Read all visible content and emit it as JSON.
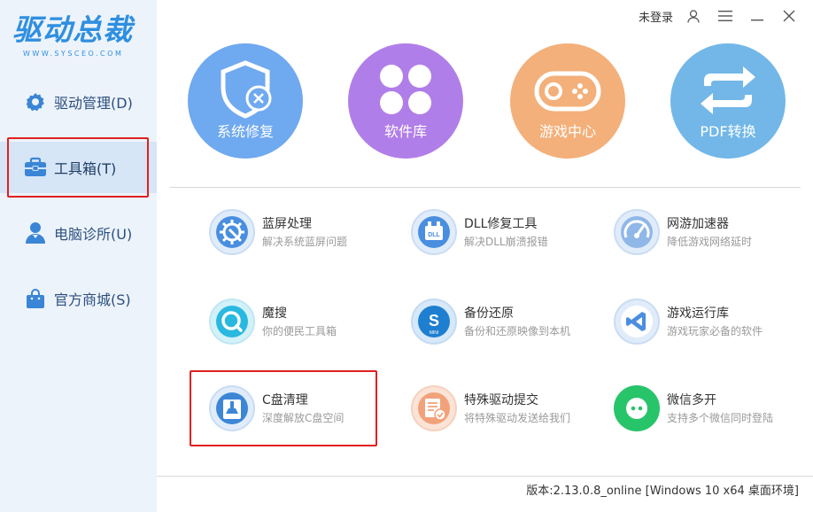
{
  "logo": {
    "title": "驱动总裁",
    "subtitle": "WWW.SYSCEO.COM"
  },
  "sidebar": {
    "items": [
      {
        "label": "驱动管理(D)"
      },
      {
        "label": "工具箱(T)"
      },
      {
        "label": "电脑诊所(U)"
      },
      {
        "label": "官方商城(S)"
      }
    ]
  },
  "topbar": {
    "login": "未登录"
  },
  "big_tools": [
    {
      "label": "系统修复",
      "color": "#6fa9ef"
    },
    {
      "label": "软件库",
      "color": "#b07ee8"
    },
    {
      "label": "游戏中心",
      "color": "#f3b07a"
    },
    {
      "label": "PDF转换",
      "color": "#72b7e8"
    }
  ],
  "tools": [
    {
      "title": "蓝屏处理",
      "desc": "解决系统蓝屏问题"
    },
    {
      "title": "DLL修复工具",
      "desc": "解决DLL崩溃报错"
    },
    {
      "title": "网游加速器",
      "desc": "降低游戏网络延时"
    },
    {
      "title": "魔搜",
      "desc": "你的便民工具箱"
    },
    {
      "title": "备份还原",
      "desc": "备份和还原映像到本机"
    },
    {
      "title": "游戏运行库",
      "desc": "游戏玩家必备的软件"
    },
    {
      "title": "C盘清理",
      "desc": "深度解放C盘空间"
    },
    {
      "title": "特殊驱动提交",
      "desc": "将特殊驱动发送给我们"
    },
    {
      "title": "微信多开",
      "desc": "支持多个微信同时登陆"
    }
  ],
  "footer": {
    "version": "版本:2.13.0.8_online [Windows 10 x64 桌面环境]"
  }
}
